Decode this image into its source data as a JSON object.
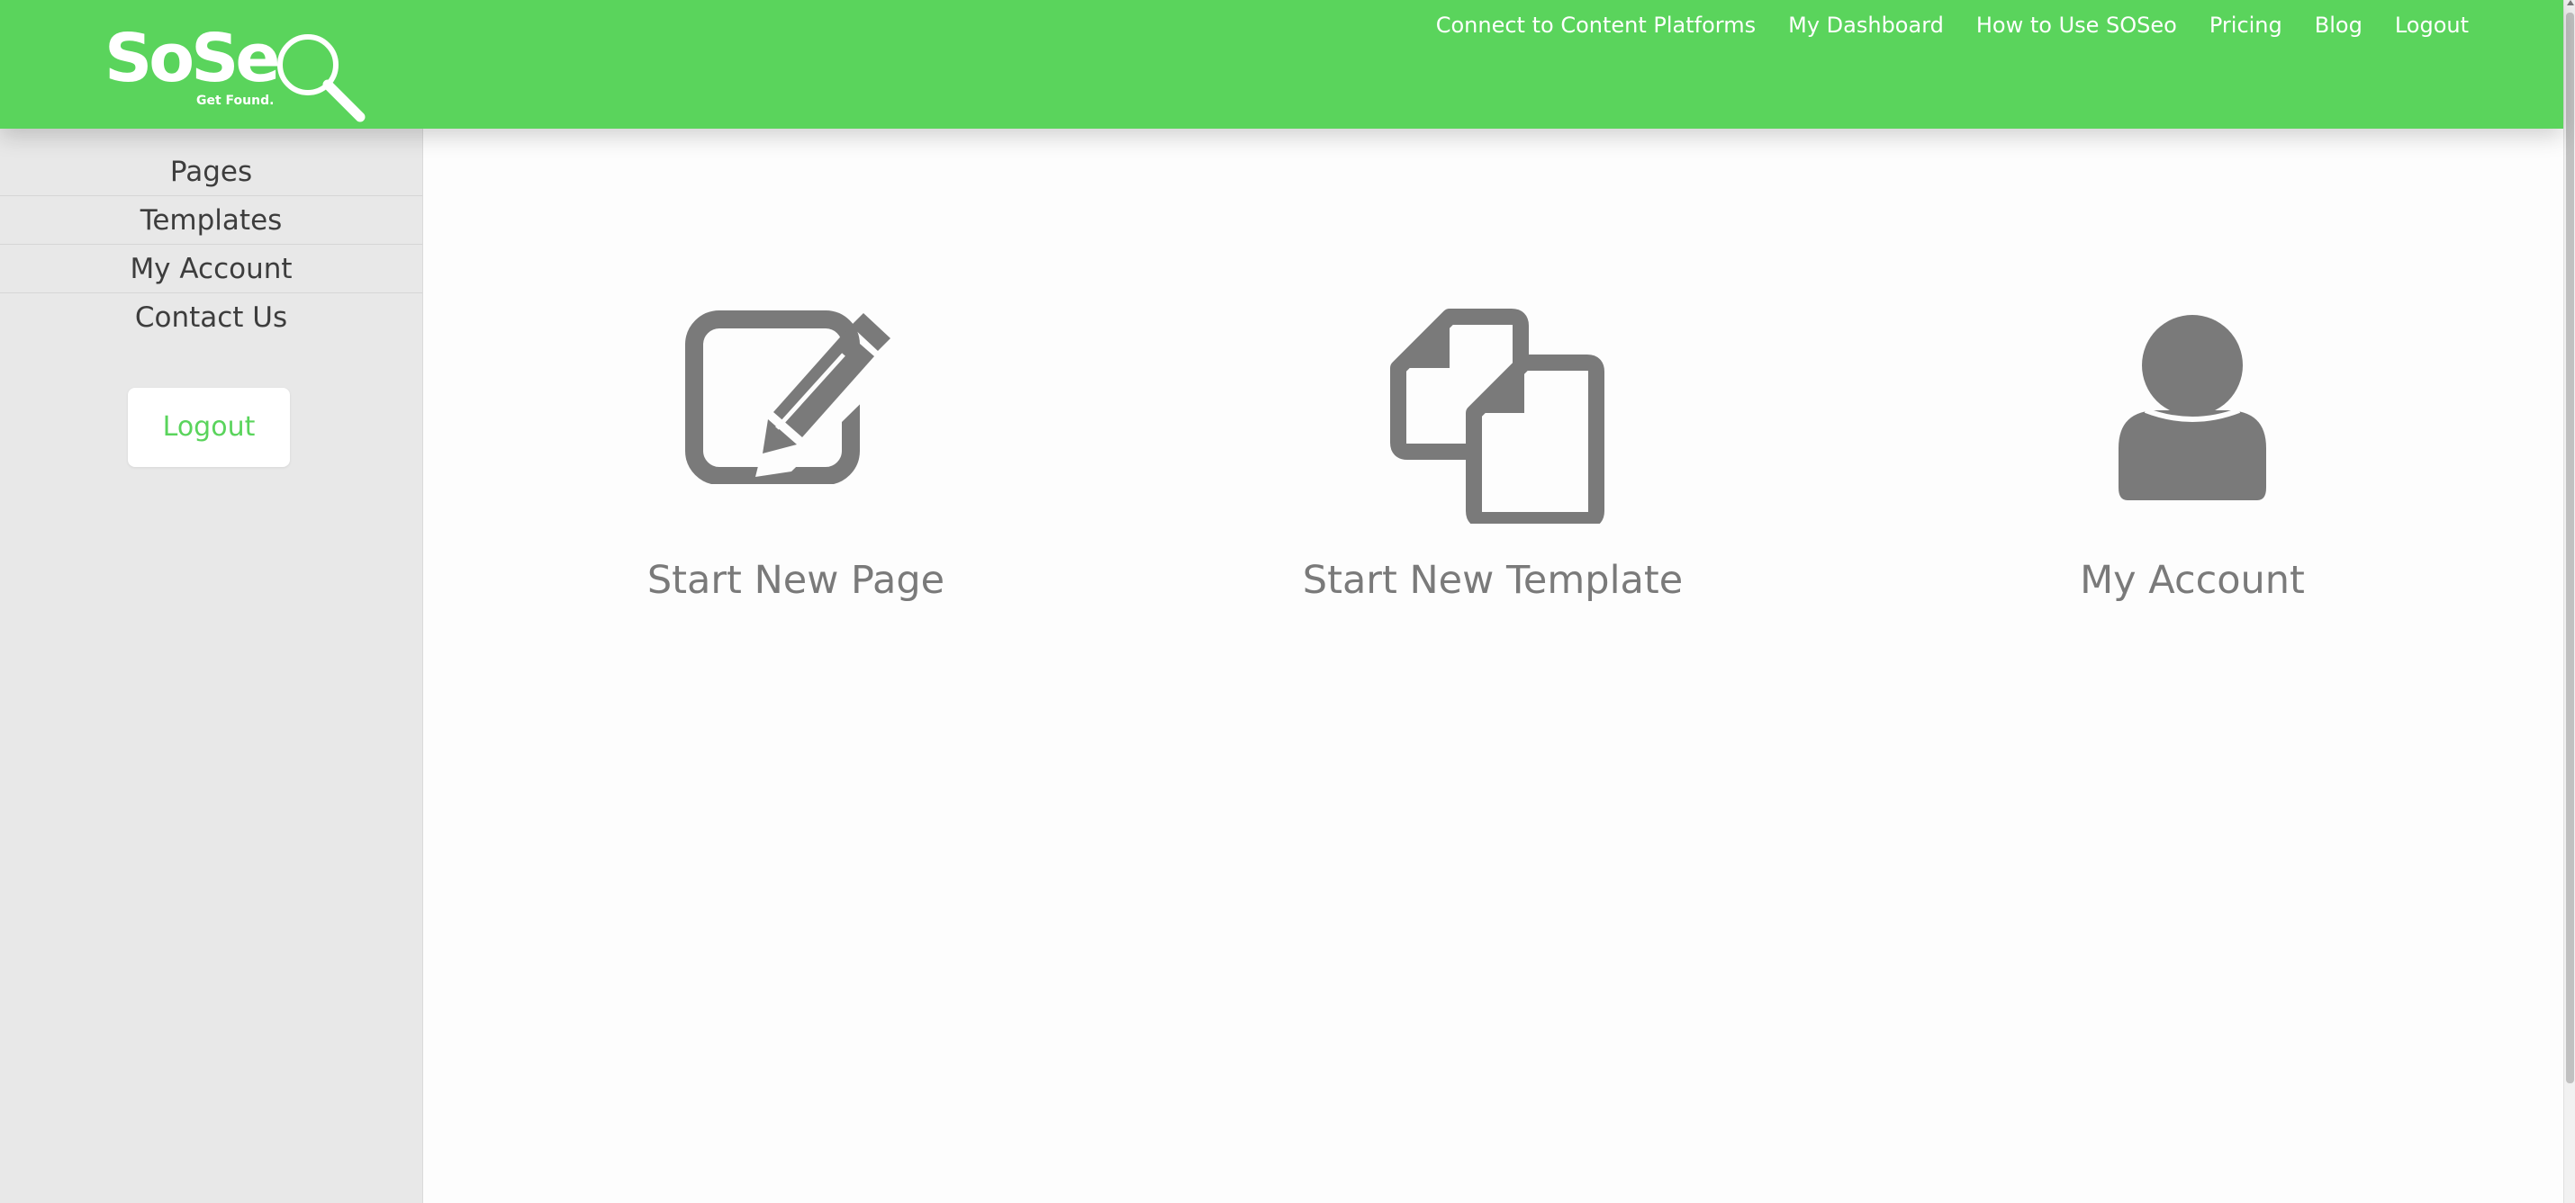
{
  "brand": {
    "name": "SoSe",
    "tagline": "Get Found.",
    "primary_color": "#5ad45c"
  },
  "topnav": {
    "items": [
      "Connect to Content Platforms",
      "My Dashboard",
      "How to Use SOSeo",
      "Pricing",
      "Blog",
      "Logout"
    ]
  },
  "sidebar": {
    "items": [
      "Pages",
      "Templates",
      "My Account",
      "Contact Us"
    ],
    "logout_label": "Logout"
  },
  "cards": [
    {
      "label": "Start New Page",
      "icon": "edit-icon"
    },
    {
      "label": "Start New Template",
      "icon": "copy-documents-icon"
    },
    {
      "label": "My Account",
      "icon": "user-icon"
    }
  ]
}
